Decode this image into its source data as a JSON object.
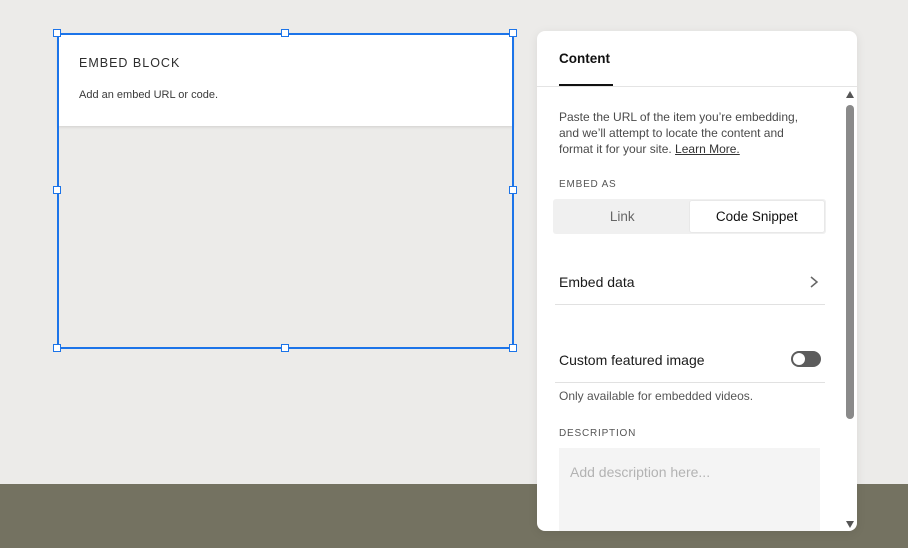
{
  "canvas": {
    "block": {
      "title": "EMBED BLOCK",
      "hint": "Add an embed URL or code."
    }
  },
  "panel": {
    "tab": "Content",
    "intro": "Paste the URL of the item you’re embedding, and we’ll attempt to locate the content and format it for your site.",
    "learn_more": "Learn More.",
    "embed_as_label": "EMBED AS",
    "embed_as_options": [
      "Link",
      "Code Snippet"
    ],
    "embed_as_selected": "Code Snippet",
    "embed_data_label": "Embed data",
    "custom_image_label": "Custom featured image",
    "custom_image_enabled": false,
    "custom_image_note": "Only available for embedded videos.",
    "description_label": "DESCRIPTION",
    "description_placeholder": "Add description here...",
    "description_value": ""
  },
  "colors": {
    "selection": "#1c74e9",
    "canvas_bg": "#ecebe9",
    "footer_band": "#747261",
    "toggle_off": "#5c5c5c"
  },
  "icons": {
    "embed_data_chevron": "chevron-right-icon",
    "scroll_up": "arrow-up-icon",
    "scroll_down": "arrow-down-icon"
  }
}
